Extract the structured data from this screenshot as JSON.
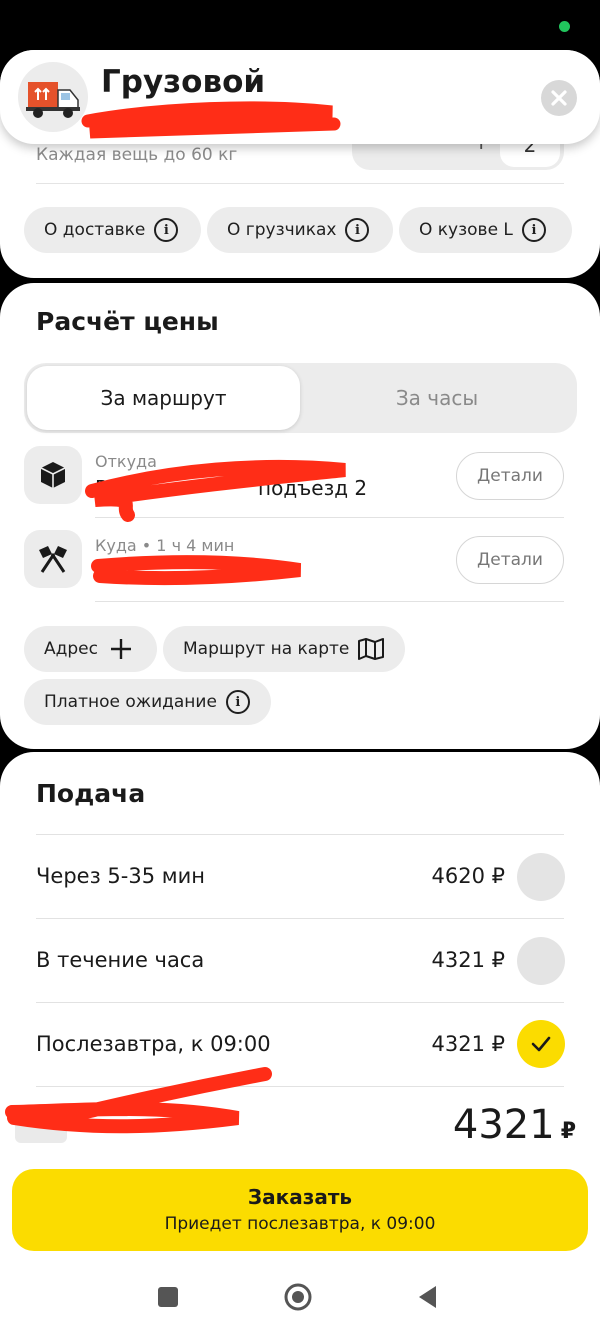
{
  "header": {
    "title": "Грузовой",
    "subtitle": "",
    "close_icon": "close-icon"
  },
  "weight_row": {
    "text": "Каждая вещь до 60 кг",
    "stepper_value": "2"
  },
  "info_chips": [
    {
      "label": "О доставке"
    },
    {
      "label": "О грузчиках"
    },
    {
      "label": "О кузове L"
    }
  ],
  "price": {
    "title": "Расчёт цены",
    "tabs": {
      "route": "За маршрут",
      "hours": "За часы"
    },
    "from": {
      "label": "Откуда",
      "address": "В",
      "address_tail": "подъезд 2",
      "details": "Детали"
    },
    "to": {
      "label": "Куда • 1 ч 4 мин",
      "address": "",
      "details": "Детали"
    },
    "chips": {
      "address": "Адрес",
      "map": "Маршрут на карте",
      "waiting": "Платное ожидание"
    }
  },
  "supply": {
    "title": "Подача",
    "options": [
      {
        "label": "Через 5-35 мин",
        "price": "4620 ₽",
        "selected": false
      },
      {
        "label": "В течение часа",
        "price": "4321 ₽",
        "selected": false
      },
      {
        "label": "Послезавтра, к 09:00",
        "price": "4321 ₽",
        "selected": true
      }
    ],
    "total": "4321",
    "currency": "₽"
  },
  "order_button": {
    "label": "Заказать",
    "sublabel": "Приедет послезавтра, к 09:00"
  },
  "colors": {
    "accent": "#fbdc00",
    "redaction": "#ff2d17"
  }
}
